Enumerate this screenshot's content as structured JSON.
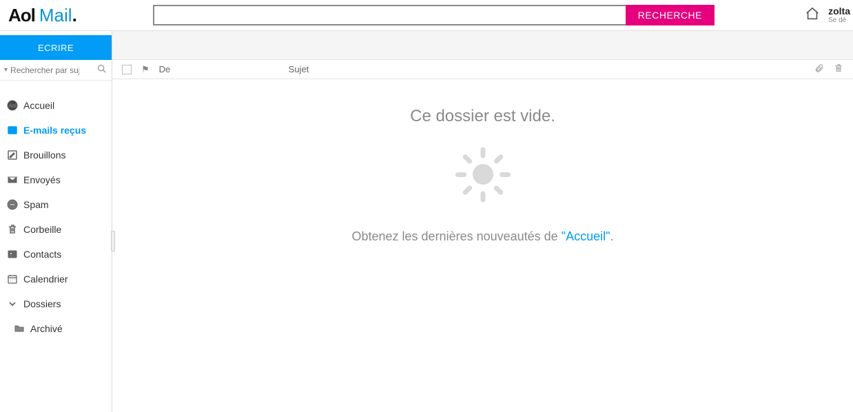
{
  "header": {
    "logo_aol": "Aol",
    "logo_mail": "Mail",
    "logo_dot": ".",
    "search_value": "",
    "search_button": "RECHERCHE",
    "user_name": "zolta",
    "user_sub": "Se dé"
  },
  "sidebar": {
    "compose": "ECRIRE",
    "search_placeholder": "Rechercher par suj",
    "items": [
      {
        "label": "Accueil",
        "icon": "aol-circle"
      },
      {
        "label": "E-mails reçus",
        "icon": "inbox",
        "active": true
      },
      {
        "label": "Brouillons",
        "icon": "draft"
      },
      {
        "label": "Envoyés",
        "icon": "sent"
      },
      {
        "label": "Spam",
        "icon": "spam"
      },
      {
        "label": "Corbeille",
        "icon": "trash"
      },
      {
        "label": "Contacts",
        "icon": "contacts"
      },
      {
        "label": "Calendrier",
        "icon": "calendar"
      },
      {
        "label": "Dossiers",
        "icon": "chevron"
      },
      {
        "label": "Archivé",
        "icon": "folder",
        "sub": true
      }
    ]
  },
  "columns": {
    "from": "De",
    "subject": "Sujet"
  },
  "empty": {
    "title": "Ce dossier est vide.",
    "text_prefix": "Obtenez les dernières nouveautés de ",
    "link_text": "\"Accueil\"",
    "text_suffix": "."
  }
}
